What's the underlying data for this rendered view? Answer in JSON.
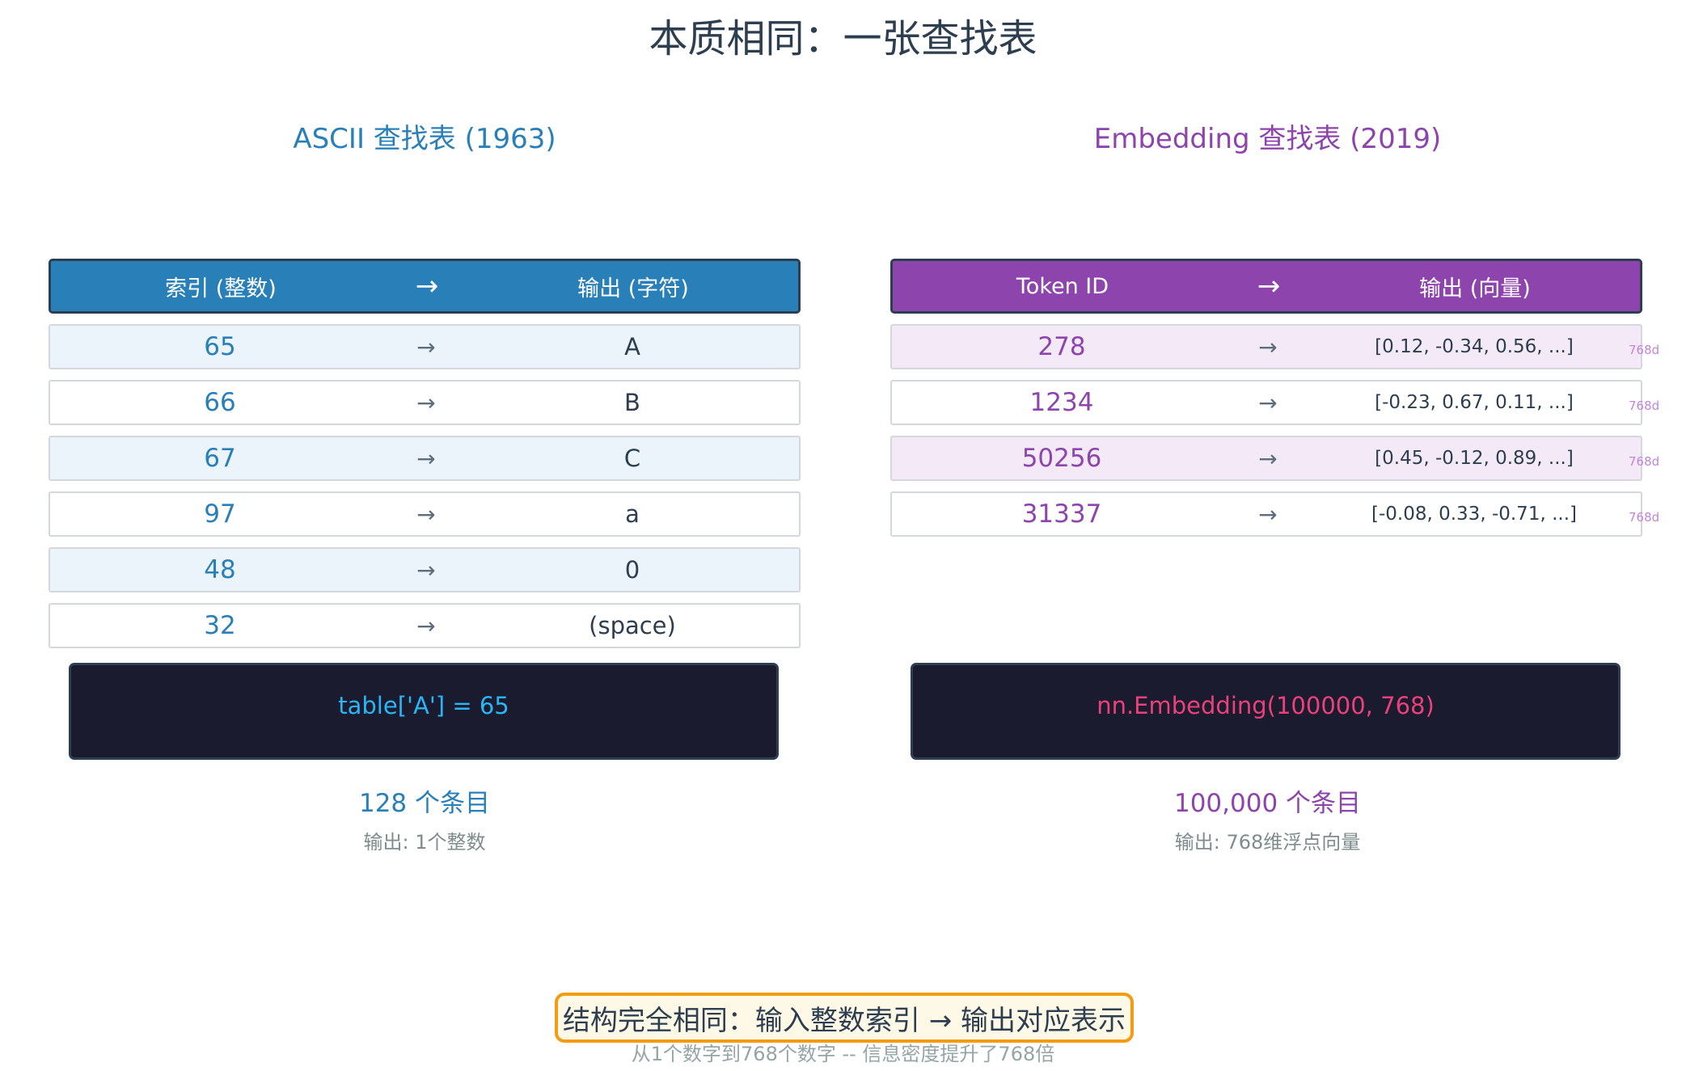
{
  "title": "本质相同：一张查找表",
  "left": {
    "title": "ASCII 查找表 (1963)",
    "header": {
      "index": "索引 (整数)",
      "arrow": "→",
      "output": "输出 (字符)"
    },
    "rows": [
      {
        "index": "65",
        "arrow": "→",
        "output": "A"
      },
      {
        "index": "66",
        "arrow": "→",
        "output": "B"
      },
      {
        "index": "67",
        "arrow": "→",
        "output": "C"
      },
      {
        "index": "97",
        "arrow": "→",
        "output": "a"
      },
      {
        "index": "48",
        "arrow": "→",
        "output": "0"
      },
      {
        "index": "32",
        "arrow": "→",
        "output": "(space)"
      }
    ],
    "code": "table['A'] = 65",
    "count": "128 个条目",
    "note": "输出: 1个整数"
  },
  "right": {
    "title": "Embedding 查找表 (2019)",
    "header": {
      "index": "Token ID",
      "arrow": "→",
      "output": "输出 (向量)"
    },
    "rows": [
      {
        "index": "278",
        "arrow": "→",
        "output": "[0.12, -0.34, 0.56, ...]",
        "dim": "768d"
      },
      {
        "index": "1234",
        "arrow": "→",
        "output": "[-0.23, 0.67, 0.11, ...]",
        "dim": "768d"
      },
      {
        "index": "50256",
        "arrow": "→",
        "output": "[0.45, -0.12, 0.89, ...]",
        "dim": "768d"
      },
      {
        "index": "31337",
        "arrow": "→",
        "output": "[-0.08, 0.33, -0.71, ...]",
        "dim": "768d"
      }
    ],
    "code": "nn.Embedding(100000, 768)",
    "count": "100,000 个条目",
    "note": "输出: 768维浮点向量"
  },
  "conclusion": "结构完全相同：输入整数索引 → 输出对应表示",
  "footnote": "从1个数字到768个数字 -- 信息密度提升了768倍",
  "colors": {
    "ascii_accent": "#2980b9",
    "embedding_accent": "#8e44ad",
    "code_bg": "#1a1b2e",
    "ascii_code_text": "#29b6f6",
    "embedding_code_text": "#ec407a",
    "highlight_border": "#f39c12"
  }
}
